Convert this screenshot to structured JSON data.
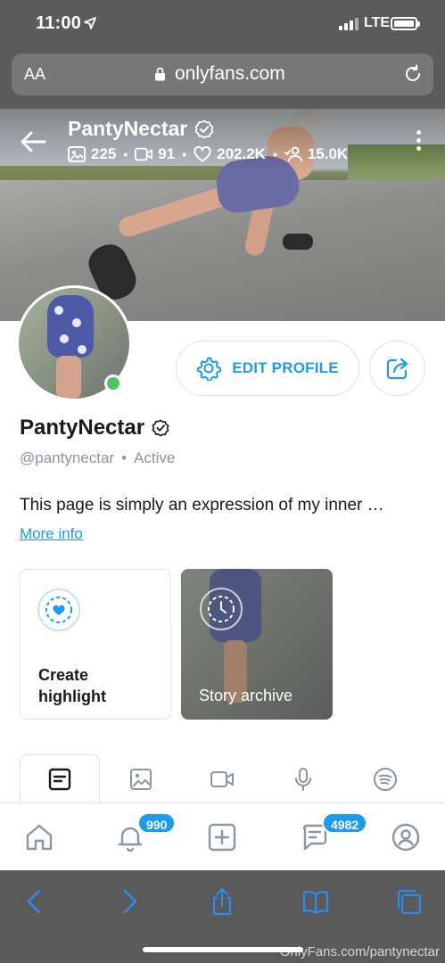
{
  "status_bar": {
    "time": "11:00",
    "network": "LTE"
  },
  "url_bar": {
    "text_size_label": "AA",
    "domain": "onlyfans.com"
  },
  "cover": {
    "name": "PantyNectar",
    "stats": {
      "photos": "225",
      "videos": "91",
      "likes": "202.2K",
      "fans": "15.0K"
    }
  },
  "actions": {
    "edit_profile_label": "EDIT PROFILE"
  },
  "profile": {
    "name": "PantyNectar",
    "handle": "@pantynectar",
    "status": "Active",
    "bio": "This page is simply an expression of my inner …",
    "more_info_label": "More info"
  },
  "highlights": {
    "create_label": "Create highlight",
    "archive_label": "Story archive"
  },
  "tabs": [
    "posts-icon",
    "photos-icon",
    "videos-icon",
    "audio-icon",
    "spotify-icon"
  ],
  "bottom_nav": {
    "notifications_badge": "990",
    "messages_badge": "4982"
  },
  "watermark": "OnlyFans.com/pantynectar",
  "colors": {
    "accent": "#1d9bf0",
    "online": "#4bc464",
    "browser_chrome": "#5b5b5b"
  }
}
